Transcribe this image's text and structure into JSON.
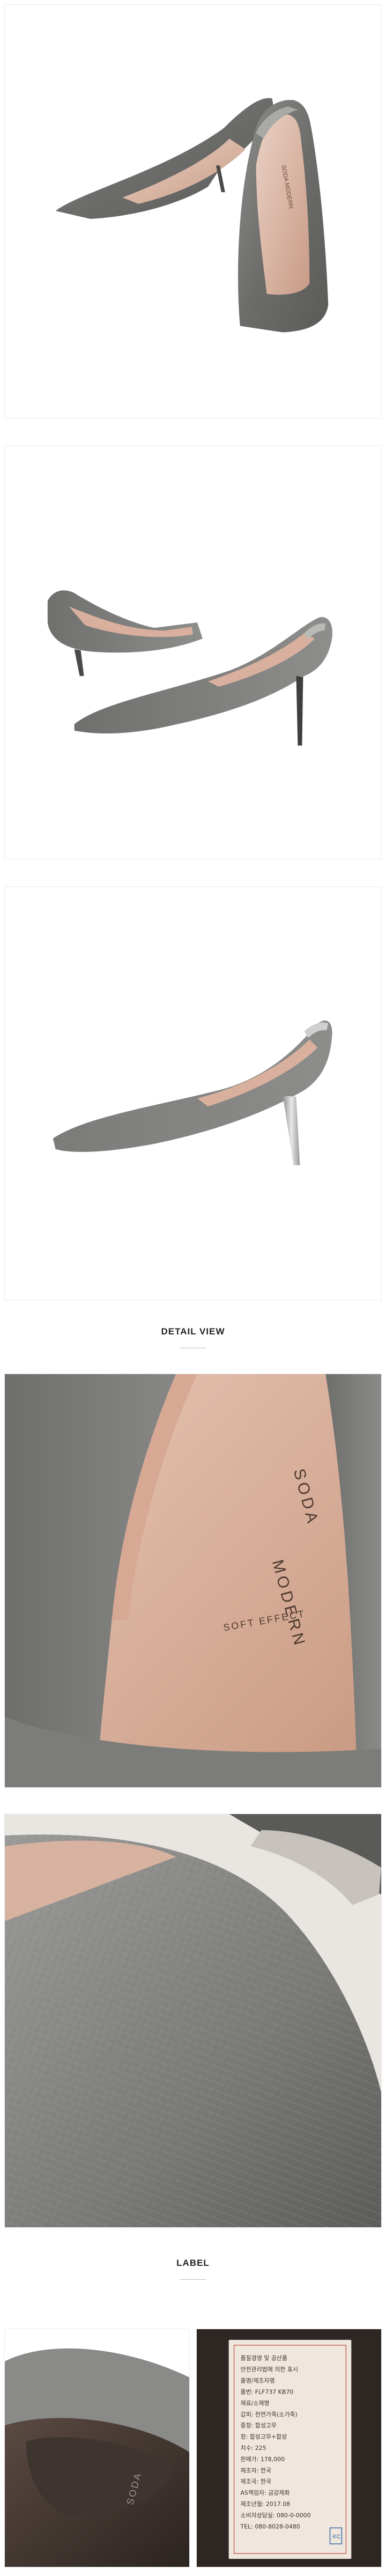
{
  "sections": {
    "detail_title": "DETAIL VIEW",
    "label_title": "LABEL"
  },
  "insole": {
    "brand_line1": "SODA",
    "brand_line2": "MODERN",
    "soft_effect": "SOFT EFFECT"
  },
  "outsole": {
    "brand": "SODA"
  },
  "label_card": {
    "lines": [
      "품질경영 및 공산품",
      "안전관리법에 의한 표시",
      "품명/제조자명",
      "품번: FLF737 KB70",
      "재료/소재명",
      "갑피: 천연가죽(소가죽)",
      "중창: 합성고무",
      "창: 합성고무+합성",
      "치수: 225",
      "판매가: 178,000",
      "제조자: 한국",
      "제조국: 한국",
      "AS책임자: 금강제화",
      "제조년월: 2017.08",
      "소비자상담실: 080-0-0000",
      "TEL: 080-8028-0480"
    ],
    "colors": {
      "paper": "#efe6dd",
      "ink": "#3a332e",
      "accent": "#c24a3d"
    }
  }
}
